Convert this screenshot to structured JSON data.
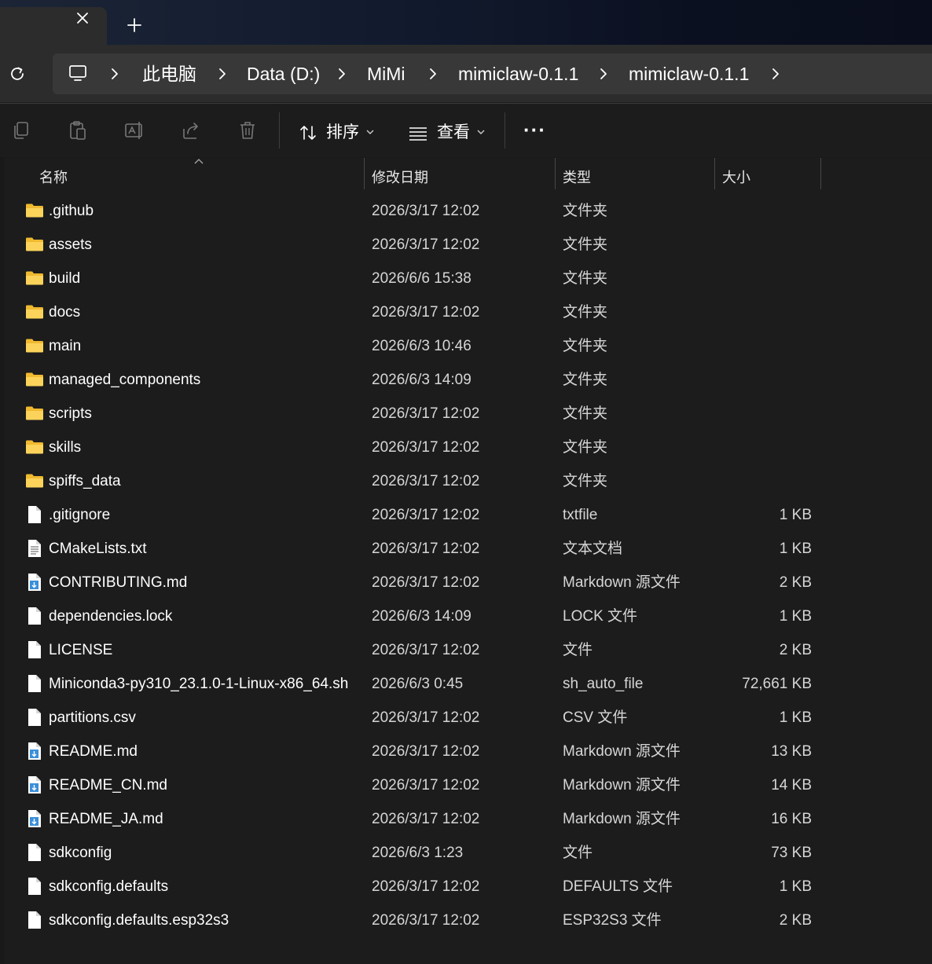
{
  "tabbar": {
    "close_icon": "close-icon",
    "new_tab_icon": "plus-icon"
  },
  "address": {
    "refresh_icon": "refresh-icon",
    "pc_icon": "computer-icon",
    "crumbs": [
      "此电脑",
      "Data (D:)",
      "MiMi",
      "mimiclaw-0.1.1",
      "mimiclaw-0.1.1"
    ]
  },
  "toolbar": {
    "copy_icon": "copy-icon",
    "paste_icon": "paste-icon",
    "rename_icon": "rename-icon",
    "share_icon": "share-icon",
    "delete_icon": "delete-icon",
    "sort_label": "排序",
    "view_label": "查看",
    "more_label": "···"
  },
  "columns": {
    "name": "名称",
    "date": "修改日期",
    "type": "类型",
    "size": "大小"
  },
  "files": [
    {
      "name": ".github",
      "date": "2026/3/17 12:02",
      "type": "文件夹",
      "size": "",
      "icon": "folder"
    },
    {
      "name": "assets",
      "date": "2026/3/17 12:02",
      "type": "文件夹",
      "size": "",
      "icon": "folder"
    },
    {
      "name": "build",
      "date": "2026/6/6 15:38",
      "type": "文件夹",
      "size": "",
      "icon": "folder"
    },
    {
      "name": "docs",
      "date": "2026/3/17 12:02",
      "type": "文件夹",
      "size": "",
      "icon": "folder"
    },
    {
      "name": "main",
      "date": "2026/6/3 10:46",
      "type": "文件夹",
      "size": "",
      "icon": "folder"
    },
    {
      "name": "managed_components",
      "date": "2026/6/3 14:09",
      "type": "文件夹",
      "size": "",
      "icon": "folder"
    },
    {
      "name": "scripts",
      "date": "2026/3/17 12:02",
      "type": "文件夹",
      "size": "",
      "icon": "folder"
    },
    {
      "name": "skills",
      "date": "2026/3/17 12:02",
      "type": "文件夹",
      "size": "",
      "icon": "folder"
    },
    {
      "name": "spiffs_data",
      "date": "2026/3/17 12:02",
      "type": "文件夹",
      "size": "",
      "icon": "folder"
    },
    {
      "name": ".gitignore",
      "date": "2026/3/17 12:02",
      "type": "txtfile",
      "size": "1 KB",
      "icon": "file"
    },
    {
      "name": "CMakeLists.txt",
      "date": "2026/3/17 12:02",
      "type": "文本文档",
      "size": "1 KB",
      "icon": "text"
    },
    {
      "name": "CONTRIBUTING.md",
      "date": "2026/3/17 12:02",
      "type": "Markdown 源文件",
      "size": "2 KB",
      "icon": "markdown"
    },
    {
      "name": "dependencies.lock",
      "date": "2026/6/3 14:09",
      "type": "LOCK 文件",
      "size": "1 KB",
      "icon": "file"
    },
    {
      "name": "LICENSE",
      "date": "2026/3/17 12:02",
      "type": "文件",
      "size": "2 KB",
      "icon": "file"
    },
    {
      "name": "Miniconda3-py310_23.1.0-1-Linux-x86_64.sh",
      "date": "2026/6/3 0:45",
      "type": "sh_auto_file",
      "size": "72,661 KB",
      "icon": "file"
    },
    {
      "name": "partitions.csv",
      "date": "2026/3/17 12:02",
      "type": "CSV 文件",
      "size": "1 KB",
      "icon": "file"
    },
    {
      "name": "README.md",
      "date": "2026/3/17 12:02",
      "type": "Markdown 源文件",
      "size": "13 KB",
      "icon": "markdown"
    },
    {
      "name": "README_CN.md",
      "date": "2026/3/17 12:02",
      "type": "Markdown 源文件",
      "size": "14 KB",
      "icon": "markdown"
    },
    {
      "name": "README_JA.md",
      "date": "2026/3/17 12:02",
      "type": "Markdown 源文件",
      "size": "16 KB",
      "icon": "markdown"
    },
    {
      "name": "sdkconfig",
      "date": "2026/6/3 1:23",
      "type": "文件",
      "size": "73 KB",
      "icon": "file"
    },
    {
      "name": "sdkconfig.defaults",
      "date": "2026/3/17 12:02",
      "type": "DEFAULTS 文件",
      "size": "1 KB",
      "icon": "file"
    },
    {
      "name": "sdkconfig.defaults.esp32s3",
      "date": "2026/3/17 12:02",
      "type": "ESP32S3 文件",
      "size": "2 KB",
      "icon": "file"
    }
  ],
  "colors": {
    "folder": "#f5c343",
    "markdown_accent": "#3a8fd9",
    "background": "#1c1c1c"
  }
}
